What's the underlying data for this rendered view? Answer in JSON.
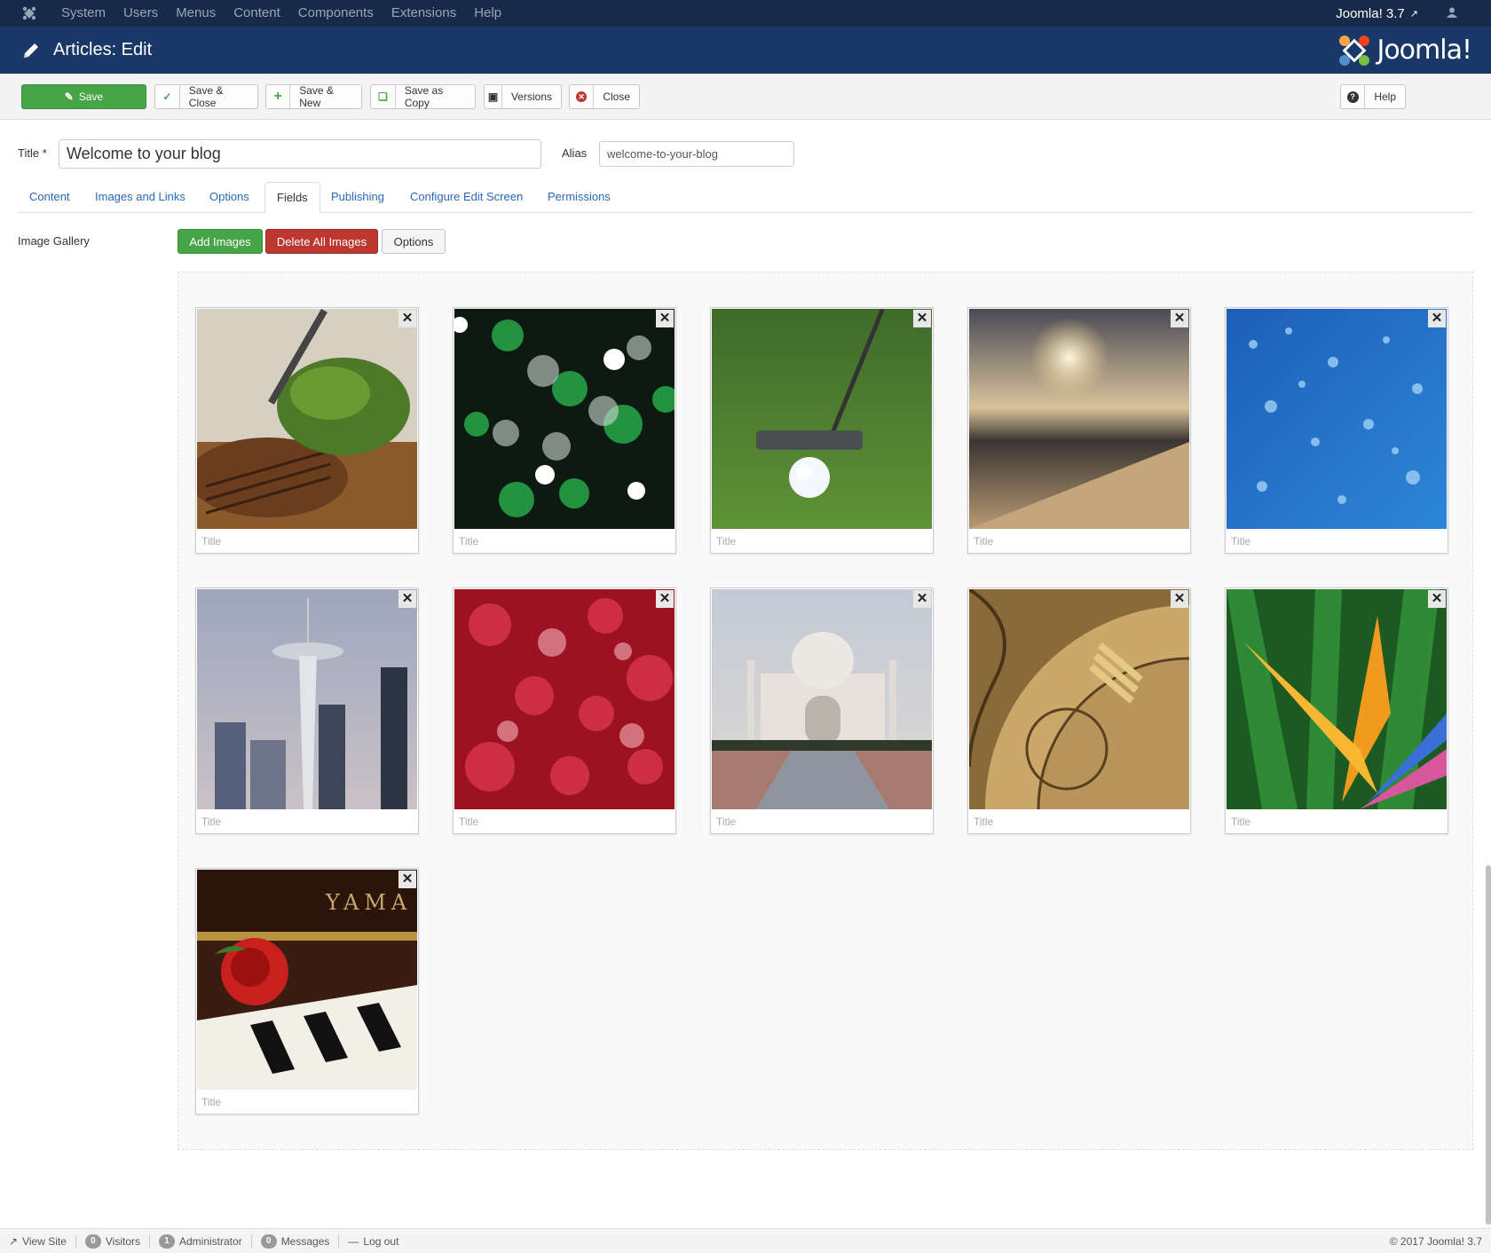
{
  "topnav": {
    "menu": [
      "System",
      "Users",
      "Menus",
      "Content",
      "Components",
      "Extensions",
      "Help"
    ],
    "version": "Joomla! 3.7"
  },
  "header": {
    "title": "Articles: Edit",
    "brand": "Joomla!"
  },
  "toolbar": {
    "save": "Save",
    "save_close": "Save & Close",
    "save_new": "Save & New",
    "save_copy": "Save as Copy",
    "versions": "Versions",
    "close": "Close",
    "help": "Help"
  },
  "form": {
    "title_label": "Title *",
    "title_value": "Welcome to your blog",
    "alias_label": "Alias",
    "alias_value": "welcome-to-your-blog"
  },
  "tabs": [
    "Content",
    "Images and Links",
    "Options",
    "Fields",
    "Publishing",
    "Configure Edit Screen",
    "Permissions"
  ],
  "gallery": {
    "label": "Image Gallery",
    "add": "Add Images",
    "delete_all": "Delete All Images",
    "options": "Options",
    "title_placeholder": "Title",
    "images": [
      "steak-salad",
      "green-bokeh",
      "golf-putter",
      "sunset-beach",
      "water-drops",
      "space-needle",
      "red-bokeh",
      "taj-mahal",
      "ornate-clock",
      "bird-of-paradise",
      "rose-piano"
    ]
  },
  "statusbar": {
    "view_site": "View Site",
    "visitors_count": "0",
    "visitors": "Visitors",
    "admin_count": "1",
    "admin": "Administrator",
    "messages_count": "0",
    "messages": "Messages",
    "logout": "Log out",
    "copyright": "© 2017 Joomla! 3.7"
  },
  "colors": {
    "header": "#1a3867",
    "topnav": "#182a4a",
    "save": "#46a546",
    "danger": "#bd362f",
    "link": "#2a69b8"
  }
}
